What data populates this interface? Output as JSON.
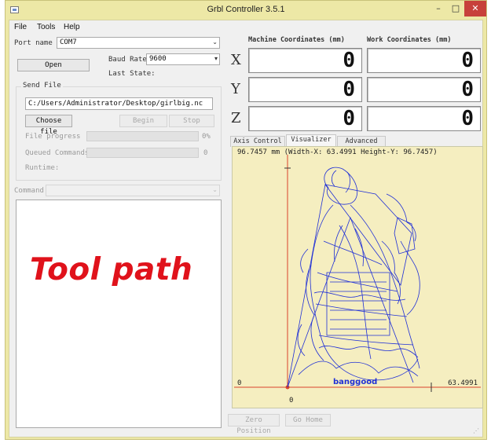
{
  "window": {
    "title": "Grbl Controller 3.5.1",
    "minimize": "–",
    "maximize": "□",
    "close": "✕"
  },
  "menu": {
    "file": "File",
    "tools": "Tools",
    "help": "Help"
  },
  "connection": {
    "port_label": "Port name",
    "port_value": "COM7",
    "open_button": "Open",
    "baud_label": "Baud Rate",
    "baud_value": "9600",
    "last_state_label": "Last State:"
  },
  "send_file": {
    "group_title": "Send File",
    "path": "C:/Users/Administrator/Desktop/girlbig.nc",
    "choose_button": "Choose file",
    "begin_button": "Begin",
    "stop_button": "Stop",
    "file_progress_label": "File progress",
    "file_progress_value": "0%",
    "queued_label": "Queued Commands",
    "queued_value": "0",
    "runtime_label": "Runtime:"
  },
  "command": {
    "label": "Command"
  },
  "console": {
    "overlay_text": "Tool path",
    "overlay_color": "#e0121b"
  },
  "coordinates": {
    "machine_header": "Machine Coordinates (mm)",
    "work_header": "Work Coordinates (mm)",
    "axes": [
      {
        "name": "X",
        "machine": "0",
        "work": "0"
      },
      {
        "name": "Y",
        "machine": "0",
        "work": "0"
      },
      {
        "name": "Z",
        "machine": "0",
        "work": "0"
      }
    ]
  },
  "tabs": [
    {
      "label": "Axis Control",
      "active": false
    },
    {
      "label": "Visualizer",
      "active": true
    },
    {
      "label": "Advanced",
      "active": false
    }
  ],
  "visualizer": {
    "info": "96.7457 mm  (Width-X: 63.4991  Height-Y: 96.7457)",
    "x_max": "63.4991",
    "origin_y": "0",
    "origin_x": "0",
    "watermark": "banggood",
    "background": "#f5eec0",
    "path_color": "#1f2fd6",
    "axis_color": "#d9432b"
  },
  "bottom_buttons": {
    "zero_position": "Zero Position",
    "go_home": "Go Home"
  }
}
